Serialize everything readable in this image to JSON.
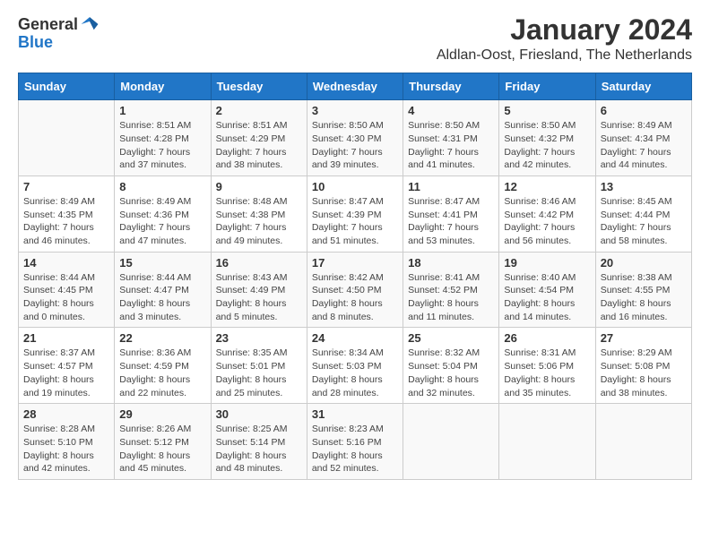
{
  "logo": {
    "general": "General",
    "blue": "Blue"
  },
  "header": {
    "title": "January 2024",
    "subtitle": "Aldlan-Oost, Friesland, The Netherlands"
  },
  "weekdays": [
    "Sunday",
    "Monday",
    "Tuesday",
    "Wednesday",
    "Thursday",
    "Friday",
    "Saturday"
  ],
  "weeks": [
    [
      {
        "day": "",
        "sunrise": "",
        "sunset": "",
        "daylight": ""
      },
      {
        "day": "1",
        "sunrise": "Sunrise: 8:51 AM",
        "sunset": "Sunset: 4:28 PM",
        "daylight": "Daylight: 7 hours and 37 minutes."
      },
      {
        "day": "2",
        "sunrise": "Sunrise: 8:51 AM",
        "sunset": "Sunset: 4:29 PM",
        "daylight": "Daylight: 7 hours and 38 minutes."
      },
      {
        "day": "3",
        "sunrise": "Sunrise: 8:50 AM",
        "sunset": "Sunset: 4:30 PM",
        "daylight": "Daylight: 7 hours and 39 minutes."
      },
      {
        "day": "4",
        "sunrise": "Sunrise: 8:50 AM",
        "sunset": "Sunset: 4:31 PM",
        "daylight": "Daylight: 7 hours and 41 minutes."
      },
      {
        "day": "5",
        "sunrise": "Sunrise: 8:50 AM",
        "sunset": "Sunset: 4:32 PM",
        "daylight": "Daylight: 7 hours and 42 minutes."
      },
      {
        "day": "6",
        "sunrise": "Sunrise: 8:49 AM",
        "sunset": "Sunset: 4:34 PM",
        "daylight": "Daylight: 7 hours and 44 minutes."
      }
    ],
    [
      {
        "day": "7",
        "sunrise": "Sunrise: 8:49 AM",
        "sunset": "Sunset: 4:35 PM",
        "daylight": "Daylight: 7 hours and 46 minutes."
      },
      {
        "day": "8",
        "sunrise": "Sunrise: 8:49 AM",
        "sunset": "Sunset: 4:36 PM",
        "daylight": "Daylight: 7 hours and 47 minutes."
      },
      {
        "day": "9",
        "sunrise": "Sunrise: 8:48 AM",
        "sunset": "Sunset: 4:38 PM",
        "daylight": "Daylight: 7 hours and 49 minutes."
      },
      {
        "day": "10",
        "sunrise": "Sunrise: 8:47 AM",
        "sunset": "Sunset: 4:39 PM",
        "daylight": "Daylight: 7 hours and 51 minutes."
      },
      {
        "day": "11",
        "sunrise": "Sunrise: 8:47 AM",
        "sunset": "Sunset: 4:41 PM",
        "daylight": "Daylight: 7 hours and 53 minutes."
      },
      {
        "day": "12",
        "sunrise": "Sunrise: 8:46 AM",
        "sunset": "Sunset: 4:42 PM",
        "daylight": "Daylight: 7 hours and 56 minutes."
      },
      {
        "day": "13",
        "sunrise": "Sunrise: 8:45 AM",
        "sunset": "Sunset: 4:44 PM",
        "daylight": "Daylight: 7 hours and 58 minutes."
      }
    ],
    [
      {
        "day": "14",
        "sunrise": "Sunrise: 8:44 AM",
        "sunset": "Sunset: 4:45 PM",
        "daylight": "Daylight: 8 hours and 0 minutes."
      },
      {
        "day": "15",
        "sunrise": "Sunrise: 8:44 AM",
        "sunset": "Sunset: 4:47 PM",
        "daylight": "Daylight: 8 hours and 3 minutes."
      },
      {
        "day": "16",
        "sunrise": "Sunrise: 8:43 AM",
        "sunset": "Sunset: 4:49 PM",
        "daylight": "Daylight: 8 hours and 5 minutes."
      },
      {
        "day": "17",
        "sunrise": "Sunrise: 8:42 AM",
        "sunset": "Sunset: 4:50 PM",
        "daylight": "Daylight: 8 hours and 8 minutes."
      },
      {
        "day": "18",
        "sunrise": "Sunrise: 8:41 AM",
        "sunset": "Sunset: 4:52 PM",
        "daylight": "Daylight: 8 hours and 11 minutes."
      },
      {
        "day": "19",
        "sunrise": "Sunrise: 8:40 AM",
        "sunset": "Sunset: 4:54 PM",
        "daylight": "Daylight: 8 hours and 14 minutes."
      },
      {
        "day": "20",
        "sunrise": "Sunrise: 8:38 AM",
        "sunset": "Sunset: 4:55 PM",
        "daylight": "Daylight: 8 hours and 16 minutes."
      }
    ],
    [
      {
        "day": "21",
        "sunrise": "Sunrise: 8:37 AM",
        "sunset": "Sunset: 4:57 PM",
        "daylight": "Daylight: 8 hours and 19 minutes."
      },
      {
        "day": "22",
        "sunrise": "Sunrise: 8:36 AM",
        "sunset": "Sunset: 4:59 PM",
        "daylight": "Daylight: 8 hours and 22 minutes."
      },
      {
        "day": "23",
        "sunrise": "Sunrise: 8:35 AM",
        "sunset": "Sunset: 5:01 PM",
        "daylight": "Daylight: 8 hours and 25 minutes."
      },
      {
        "day": "24",
        "sunrise": "Sunrise: 8:34 AM",
        "sunset": "Sunset: 5:03 PM",
        "daylight": "Daylight: 8 hours and 28 minutes."
      },
      {
        "day": "25",
        "sunrise": "Sunrise: 8:32 AM",
        "sunset": "Sunset: 5:04 PM",
        "daylight": "Daylight: 8 hours and 32 minutes."
      },
      {
        "day": "26",
        "sunrise": "Sunrise: 8:31 AM",
        "sunset": "Sunset: 5:06 PM",
        "daylight": "Daylight: 8 hours and 35 minutes."
      },
      {
        "day": "27",
        "sunrise": "Sunrise: 8:29 AM",
        "sunset": "Sunset: 5:08 PM",
        "daylight": "Daylight: 8 hours and 38 minutes."
      }
    ],
    [
      {
        "day": "28",
        "sunrise": "Sunrise: 8:28 AM",
        "sunset": "Sunset: 5:10 PM",
        "daylight": "Daylight: 8 hours and 42 minutes."
      },
      {
        "day": "29",
        "sunrise": "Sunrise: 8:26 AM",
        "sunset": "Sunset: 5:12 PM",
        "daylight": "Daylight: 8 hours and 45 minutes."
      },
      {
        "day": "30",
        "sunrise": "Sunrise: 8:25 AM",
        "sunset": "Sunset: 5:14 PM",
        "daylight": "Daylight: 8 hours and 48 minutes."
      },
      {
        "day": "31",
        "sunrise": "Sunrise: 8:23 AM",
        "sunset": "Sunset: 5:16 PM",
        "daylight": "Daylight: 8 hours and 52 minutes."
      },
      {
        "day": "",
        "sunrise": "",
        "sunset": "",
        "daylight": ""
      },
      {
        "day": "",
        "sunrise": "",
        "sunset": "",
        "daylight": ""
      },
      {
        "day": "",
        "sunrise": "",
        "sunset": "",
        "daylight": ""
      }
    ]
  ]
}
